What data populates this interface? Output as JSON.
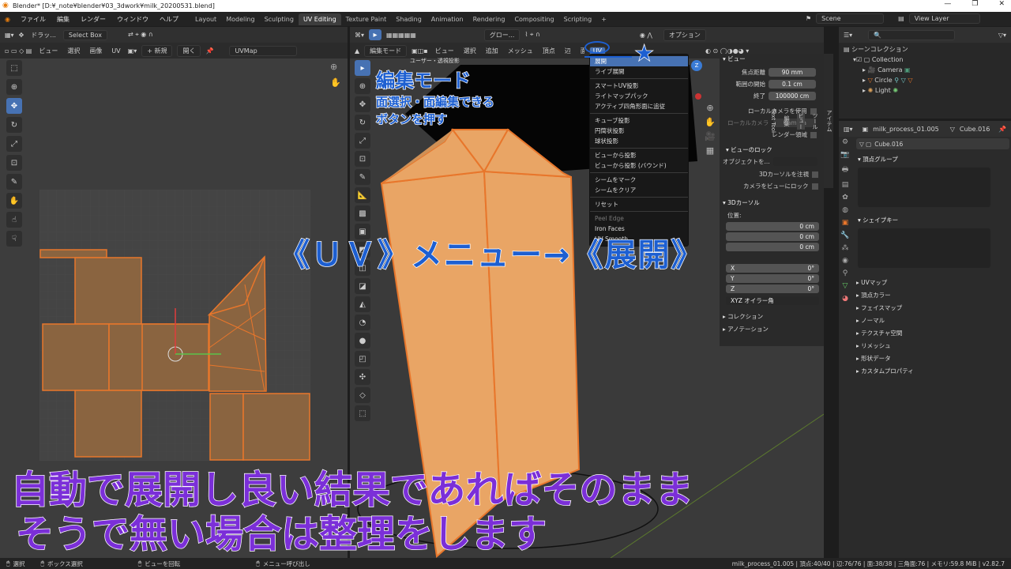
{
  "title": "Blender* [D:¥_note¥blender¥03_3dwork¥milk_20200531.blend]",
  "menus": [
    "ファイル",
    "編集",
    "レンダー",
    "ウィンドウ",
    "ヘルプ"
  ],
  "workspaces": [
    "Layout",
    "Modeling",
    "Sculpting",
    "UV Editing",
    "Texture Paint",
    "Shading",
    "Animation",
    "Rendering",
    "Compositing",
    "Scripting",
    "+"
  ],
  "scene": "Scene",
  "view_layer": "View Layer",
  "uv_editor": {
    "drag_label": "ドラッ...",
    "select_mode": "Select Box",
    "menus": [
      "ビュー",
      "選択",
      "画像",
      "UV"
    ],
    "new_btn": "+ 新規",
    "open_btn": "開く",
    "uvmap": "UVMap"
  },
  "viewport": {
    "mode": "編集モード",
    "menus": [
      "ビュー",
      "選択",
      "追加",
      "メッシュ",
      "頂点",
      "辺"
    ],
    "uv_btn": "UV",
    "global": "グロー...",
    "options": "オプション",
    "overlay_title": "ユーザー・透視投影",
    "side_tabs": [
      "アイテム",
      "ツール",
      "ビュー",
      "編集",
      "Text Tool"
    ]
  },
  "uv_menu": {
    "items": [
      "展開",
      "ライブ展開",
      "スマートUV投影",
      "ライトマップパック",
      "アクティブ四角形面に追従",
      "キューブ投影",
      "円筒状投影",
      "球状投影",
      "ビューから投影",
      "ビューから投影 (バウンド)",
      "シームをマーク",
      "シームをクリア",
      "リセット",
      "Peel Edge",
      "Iron Faces",
      "UV Smooth"
    ]
  },
  "npanel": {
    "view_title": "ビュー",
    "focal_label": "焦点距離",
    "focal": "90 mm",
    "clip_start_label": "範囲の開始",
    "clip_start": "0.1 cm",
    "clip_end_label": "終了",
    "clip_end": "100000 cm",
    "local_cam": "ローカルカメラを使用",
    "local_cam2": "ローカルカメラ",
    "camera": "Camera",
    "render_region": "レンダー領域",
    "lock_title": "ビューのロック",
    "lock_obj": "オブジェクトを...",
    "lock_cursor": "3Dカーソルを注視",
    "lock_cam": "カメラをビューにロック",
    "cursor_title": "3Dカーソル",
    "location": "位置:",
    "loc": [
      "0 cm",
      "0 cm",
      "0 cm"
    ],
    "rot_axes": [
      "X",
      "Y",
      "Z"
    ],
    "rot": [
      "0°",
      "0°",
      "0°"
    ],
    "euler": "XYZ オイラー角",
    "collection": "コレクション",
    "annotation": "アノテーション"
  },
  "outliner": {
    "root": "シーンコレクション",
    "items": [
      "Collection",
      "Camera",
      "Circle",
      "Light"
    ]
  },
  "properties": {
    "object": "milk_process_01.005",
    "mesh": "Cube.016",
    "mesh_name": "Cube.016",
    "vertex_groups": "頂点グループ",
    "shape_keys": "シェイプキー",
    "sections": [
      "UVマップ",
      "頂点カラー",
      "フェイスマップ",
      "ノーマル",
      "テクスチャ空間",
      "リメッシュ",
      "形状データ",
      "カスタムプロパティ"
    ]
  },
  "status": {
    "left": [
      "選択",
      "ボックス選択",
      "ビューを回転",
      "メニュー呼び出し"
    ],
    "right": "milk_process_01.005 | 頂点:40/40 | 辺:76/76 | 面:38/38 | 三角面:76 | メモリ:59.8 MiB | v2.82.7"
  },
  "captions": {
    "edit_mode": "編集モード",
    "note1": "面選択・面編集できる",
    "note2": "ボタンを押す",
    "main": "《ＵＶ》メニュー→《展開》",
    "bottom1": "自動で展開し良い結果であればそのまま",
    "bottom2": "そうで無い場合は整理をします"
  },
  "colors": {
    "accent": "#4772b3",
    "mesh": "#e9a565",
    "caption_purple": "#7b2fd8",
    "caption_blue": "#1d5fd1"
  }
}
